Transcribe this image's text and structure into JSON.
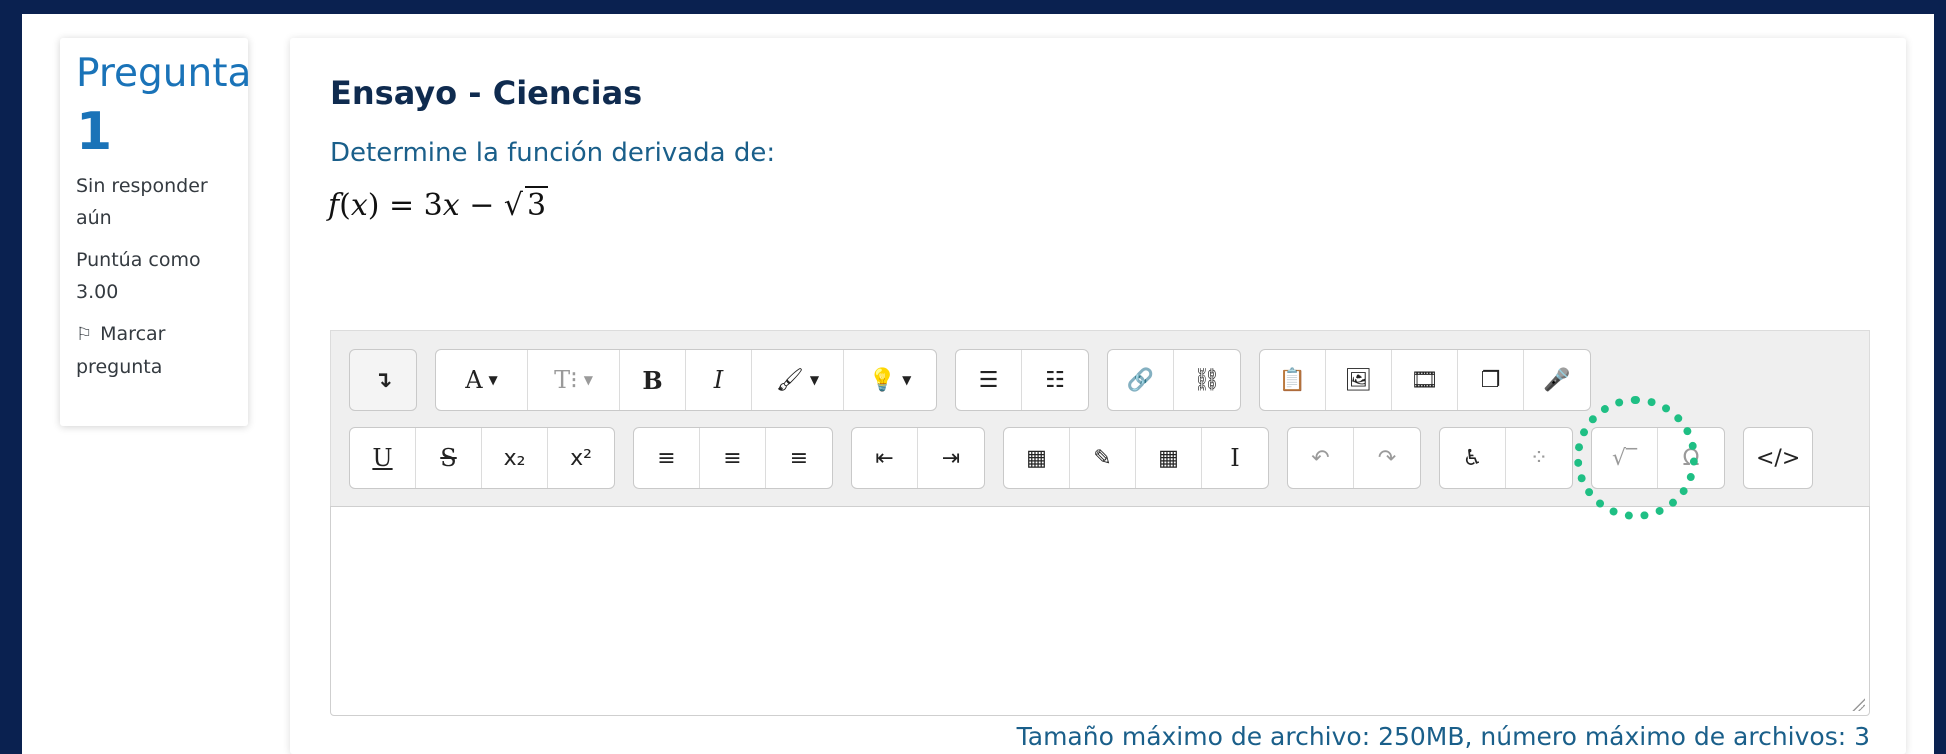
{
  "question": {
    "label": "Pregunta",
    "number": "1",
    "status": "Sin responder aún",
    "score": "Puntúa como 3.00",
    "flag_label": "Marcar pregunta"
  },
  "main": {
    "title": "Ensayo - Ciencias",
    "prompt": "Determine la función derivada de:",
    "formula": {
      "f": "f",
      "lparen": "(",
      "x": "x",
      "rparen": ")",
      "equals": " = 3",
      "x2": "x",
      "minus": " − √",
      "radicand": "3"
    }
  },
  "toolbar": {
    "row1": [
      {
        "name": "show-more-button",
        "label": "↴",
        "faint": false
      },
      {
        "name": "font-family-button",
        "label": "A"
      },
      {
        "name": "font-size-button",
        "label": "T⁝"
      },
      {
        "name": "bold-button",
        "label": "B"
      },
      {
        "name": "italic-button",
        "label": "I"
      },
      {
        "name": "font-color-button",
        "label": "🖌"
      },
      {
        "name": "background-color-button",
        "label": "💡"
      },
      {
        "name": "unordered-list-button",
        "label": "☰"
      },
      {
        "name": "ordered-list-button",
        "label": "☷"
      },
      {
        "name": "link-button",
        "label": "🔗"
      },
      {
        "name": "unlink-button",
        "label": "⛓"
      },
      {
        "name": "paste-button",
        "label": "📋"
      },
      {
        "name": "image-button",
        "label": "🖼"
      },
      {
        "name": "media-button",
        "label": "🎞"
      },
      {
        "name": "manage-files-button",
        "label": "❐"
      },
      {
        "name": "record-audio-button",
        "label": "🎤"
      }
    ],
    "row2": [
      {
        "name": "underline-button",
        "label": "U"
      },
      {
        "name": "strikethrough-button",
        "label": "S"
      },
      {
        "name": "subscript-button",
        "label": "x₂"
      },
      {
        "name": "superscript-button",
        "label": "x²"
      },
      {
        "name": "align-left-button",
        "label": "≡"
      },
      {
        "name": "align-center-button",
        "label": "≡"
      },
      {
        "name": "align-right-button",
        "label": "≡"
      },
      {
        "name": "outdent-button",
        "label": "⇤"
      },
      {
        "name": "indent-button",
        "label": "⇥"
      },
      {
        "name": "calculator-button",
        "label": "▦"
      },
      {
        "name": "edit-button",
        "label": "✎"
      },
      {
        "name": "table-button",
        "label": "▦"
      },
      {
        "name": "clear-format-button",
        "label": "I"
      },
      {
        "name": "undo-button",
        "label": "↶"
      },
      {
        "name": "redo-button",
        "label": "↷"
      },
      {
        "name": "accessibility-button",
        "label": "♿"
      },
      {
        "name": "screenreader-button",
        "label": "⁘"
      },
      {
        "name": "equation-button",
        "label": "√‾"
      },
      {
        "name": "special-char-button",
        "label": "Ω"
      },
      {
        "name": "html-button",
        "label": "</>"
      }
    ]
  },
  "footer": {
    "note": "Tamaño máximo de archivo: 250MB, número máximo de archivos: 3"
  }
}
